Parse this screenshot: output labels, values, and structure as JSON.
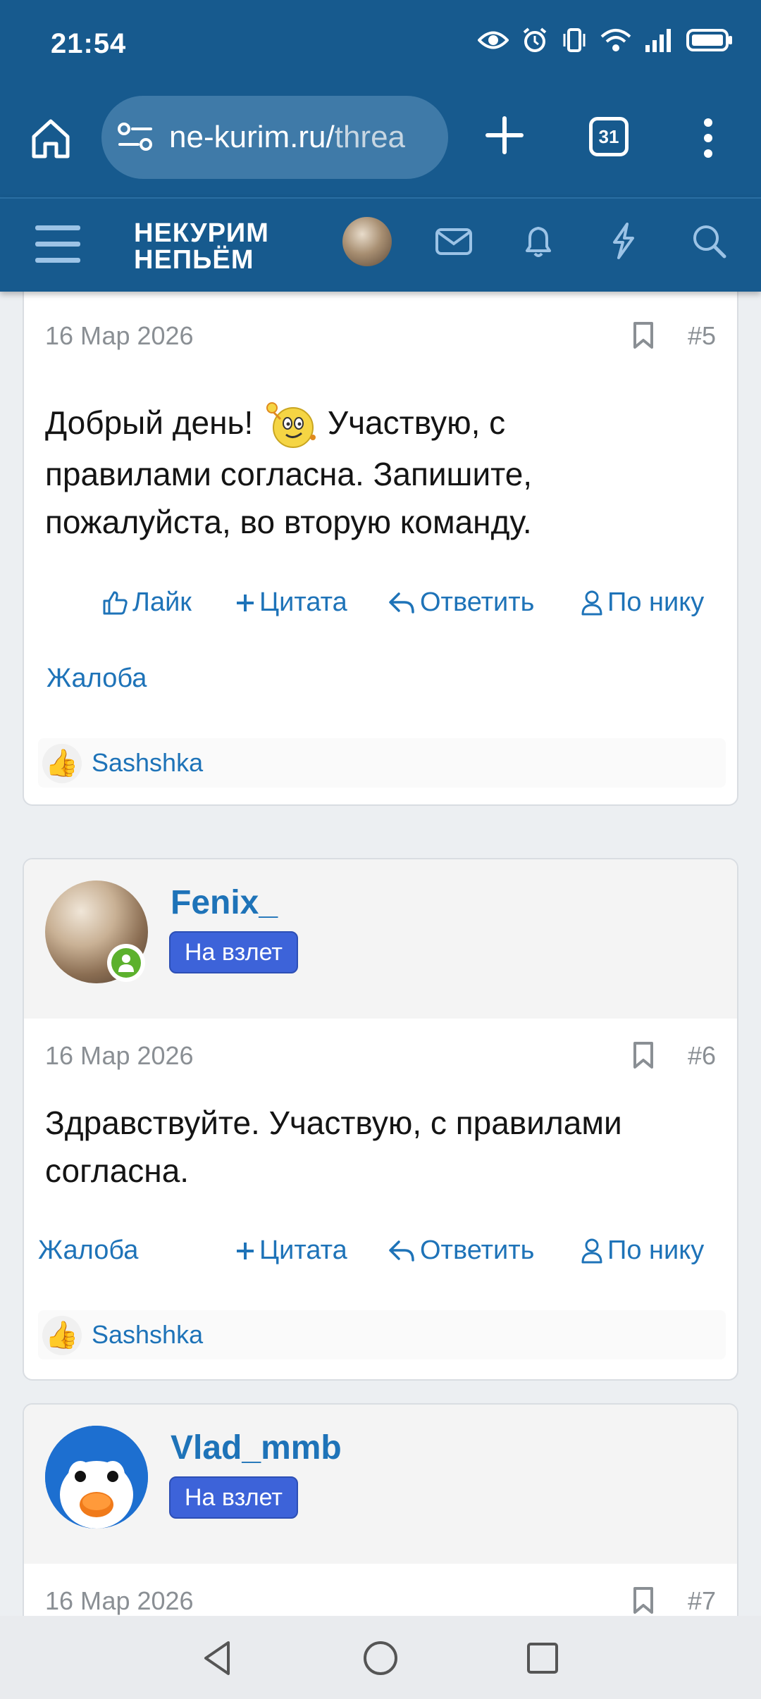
{
  "status_bar": {
    "time": "21:54"
  },
  "browser": {
    "url_main": "ne-kurim.ru/",
    "url_rest": "threa",
    "tabs_count": "31"
  },
  "site": {
    "logo_line1": "НЕКУРИМ",
    "logo_line2": "НЕПЬЁМ"
  },
  "posts": [
    {
      "date": "16 Мар 2026",
      "number": "#5",
      "text_before_smiley": "Добрый день!",
      "text_after_smiley": "Участвую, с",
      "text_line2": "правилами согласна. Запишите,",
      "text_line3": "пожалуйста, во вторую команду.",
      "actions": {
        "like": "Лайк",
        "quote": "Цитата",
        "reply": "Ответить",
        "by_nick": "По нику",
        "report": "Жалоба"
      },
      "reaction_user": "Sashshka"
    },
    {
      "username": "Fenix_",
      "rank": "На взлет",
      "date": "16 Мар 2026",
      "number": "#6",
      "text": "Здравствуйте. Участвую, с правилами согласна.",
      "actions": {
        "report": "Жалоба",
        "quote": "Цитата",
        "reply": "Ответить",
        "by_nick": "По нику"
      },
      "reaction_user": "Sashshka"
    },
    {
      "username": "Vlad_mmb",
      "rank": "На взлет",
      "date": "16 Мар 2026",
      "number": "#7"
    }
  ],
  "colors": {
    "header_bg": "#175a8e",
    "link": "#1e73b8",
    "badge": "#3d63d9",
    "online": "#5cb12d"
  }
}
